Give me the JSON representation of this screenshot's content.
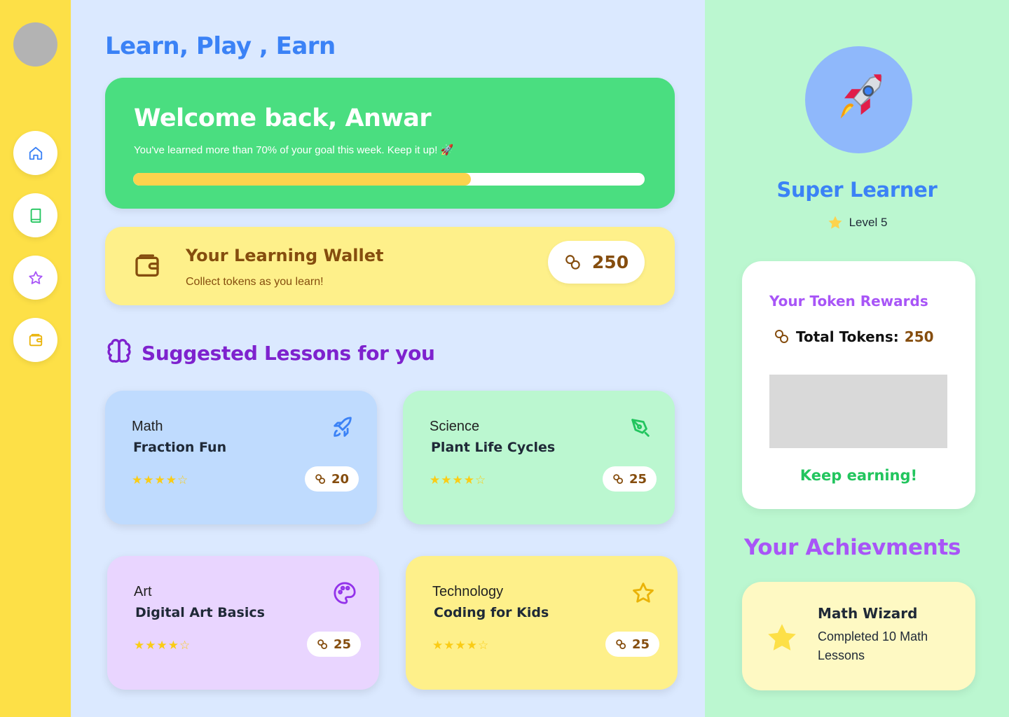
{
  "header": {
    "title": "Learn, Play , Earn"
  },
  "welcome": {
    "heading": "Welcome back, Anwar",
    "message": "You've learned more than 70% of your goal this week. Keep it up! 🚀",
    "progress_fraction": 0.66
  },
  "wallet": {
    "title": "Your Learning Wallet",
    "subtitle": "Collect tokens as you learn!",
    "tokens": "250"
  },
  "lessons_section": {
    "title": "Suggested Lessons for you"
  },
  "lessons": [
    {
      "subject": "Math",
      "title": "Fraction Fun",
      "tokens": "20",
      "rating": 4,
      "icon": "rocket-icon",
      "bg": "#bfdbfe",
      "icon_color": "#3b82f6"
    },
    {
      "subject": "Science",
      "title": "Plant Life Cycles",
      "tokens": "25",
      "rating": 4,
      "icon": "pen-tool-icon",
      "bg": "#bbf7d0",
      "icon_color": "#22c55e"
    },
    {
      "subject": "Art",
      "title": "Digital Art Basics",
      "tokens": "25",
      "rating": 4,
      "icon": "palette-icon",
      "bg": "#e9d5ff",
      "icon_color": "#9333ea"
    },
    {
      "subject": "Technology",
      "title": "Coding for Kids",
      "tokens": "25",
      "rating": 4,
      "icon": "star-icon",
      "bg": "#fef08a",
      "icon_color": "#eab308"
    }
  ],
  "profile": {
    "badge_emoji": "🚀",
    "badge_name": "Super Learner",
    "level": "Level 5"
  },
  "rewards": {
    "title": "Your Token Rewards",
    "total_label": "Total Tokens:",
    "total_value": "250",
    "footer": "Keep earning!"
  },
  "achievements": {
    "title": "Your Achievments",
    "items": [
      {
        "title": "Math Wizard",
        "description": "Completed 10 Math Lessons"
      }
    ]
  },
  "colors": {
    "sidebar": "#fde047",
    "main_bg": "#dbe9ff",
    "right_bg": "#bbf7d0",
    "accent_blue": "#3b82f6",
    "accent_purple": "#a855f7",
    "token_brown": "#854d0e"
  },
  "nav": [
    {
      "icon": "home-icon"
    },
    {
      "icon": "book-icon"
    },
    {
      "icon": "star-icon"
    },
    {
      "icon": "wallet-icon"
    }
  ]
}
